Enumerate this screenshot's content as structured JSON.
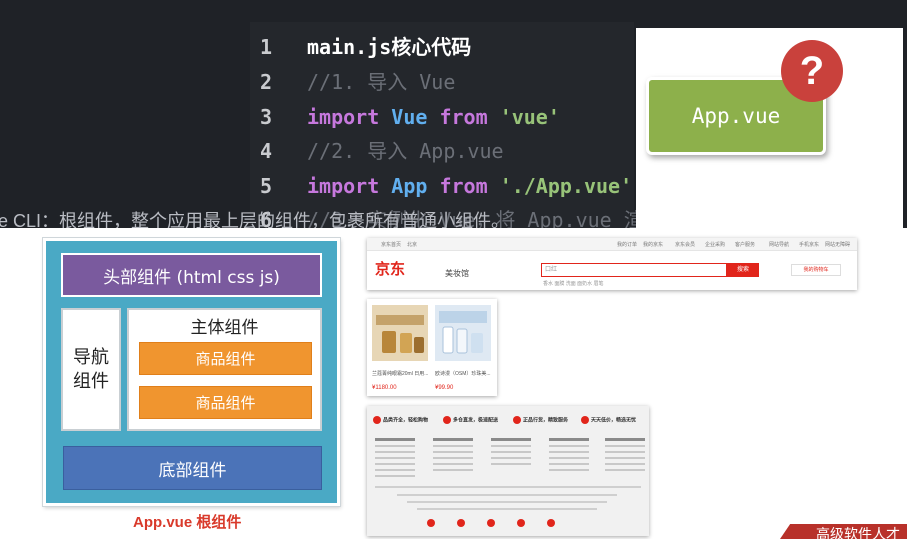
{
  "code": {
    "lines": [
      {
        "num": "1",
        "text": "main.js核心代码"
      },
      {
        "num": "2",
        "text": "//1. 导入 Vue"
      },
      {
        "num": "3",
        "kw": "import",
        "id": "Vue",
        "from": "from",
        "str": "'vue'"
      },
      {
        "num": "4",
        "text": "//2. 导入 App.vue"
      },
      {
        "num": "5",
        "kw": "import",
        "id": "App",
        "from": "from",
        "str": "'./App.vue'"
      },
      {
        "num": "6",
        "text": "//3. 实例化 Vue，将 App.vue 渲"
      }
    ]
  },
  "card": {
    "label": "App.vue",
    "icon": "question-mark-icon",
    "icon_glyph": "?"
  },
  "cut_text": "ue CLI：根组件，整个应用最上层的组件，包裹所有普通小组件。",
  "diagram": {
    "header": "头部组件 (html css js)",
    "nav": "导航组件",
    "main_title": "主体组件",
    "goods": [
      "商品组件",
      "商品组件"
    ],
    "footer": "底部组件",
    "root_label": "App.vue 根组件",
    "colors": {
      "bg": "#4aa9c5",
      "header": "#7a5a9e",
      "goods": "#f0952f",
      "footer": "#4b73b8",
      "label": "#d93a2b"
    }
  },
  "jd": {
    "logo": "京东",
    "subtitle": "美妆馆",
    "topbar": [
      "京东首页",
      "北京",
      "我的订单",
      "我的京东",
      "京东会员",
      "企业采购",
      "客户服务",
      "网站导航",
      "手机京东",
      "网站无障碍"
    ],
    "search_placeholder": "口红",
    "search_button": "搜索",
    "hot_words": "香水  面膜  洗面  面奶水  眉笔",
    "cart": "我的购物车",
    "products": [
      {
        "name": "兰蔻菁纯眼霜20ml 日用...",
        "price": "¥1180.00"
      },
      {
        "name": "欧诗漫（OSM）珍珠美...",
        "price": "¥99.90"
      }
    ],
    "services": [
      "品类齐全，轻松购物",
      "多仓直发，极速配送",
      "正品行货，精致服务",
      "天天低价，畅选无忧"
    ]
  },
  "corner_text": "高级软件人才"
}
